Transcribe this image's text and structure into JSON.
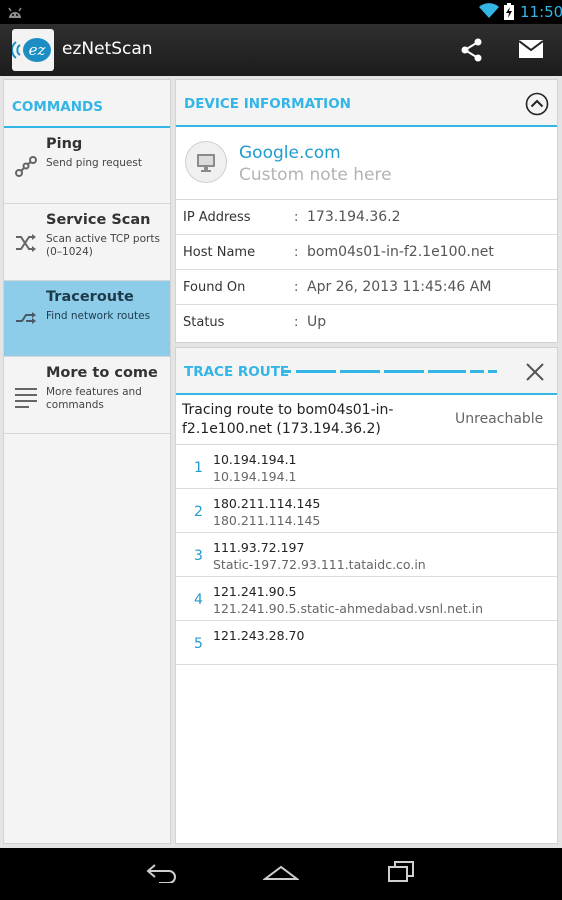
{
  "status_bar": {
    "time": "11:50"
  },
  "app": {
    "title": "ezNetScan",
    "logo_text": "ez"
  },
  "commands": {
    "header": "COMMANDS",
    "items": [
      {
        "title": "Ping",
        "description": "Send ping request",
        "icon": "ping-icon",
        "selected": false
      },
      {
        "title": "Service Scan",
        "description": "Scan active TCP ports (0–1024)",
        "icon": "shuffle-icon",
        "selected": false
      },
      {
        "title": "Traceroute",
        "description": "Find network routes",
        "icon": "route-icon",
        "selected": true
      },
      {
        "title": "More to come",
        "description": "More features and commands",
        "icon": "menu-lines-icon",
        "selected": false
      }
    ]
  },
  "device_info": {
    "header": "DEVICE INFORMATION",
    "name": "Google.com",
    "note_placeholder": "Custom note here",
    "separator": ":",
    "rows": [
      {
        "label": "IP Address",
        "value": "173.194.36.2"
      },
      {
        "label": "Host Name",
        "value": "bom04s01-in-f2.1e100.net"
      },
      {
        "label": "Found On",
        "value": "Apr 26, 2013 11:45:46 AM"
      },
      {
        "label": "Status",
        "value": "Up"
      }
    ]
  },
  "trace_route": {
    "header": "TRACE ROUTE",
    "target": "Tracing route to bom04s01-in-f2.1e100.net (173.194.36.2)",
    "status": "Unreachable",
    "hops": [
      {
        "num": "1",
        "ip": "10.194.194.1",
        "host": "10.194.194.1"
      },
      {
        "num": "2",
        "ip": "180.211.114.145",
        "host": "180.211.114.145"
      },
      {
        "num": "3",
        "ip": "111.93.72.197",
        "host": "Static-197.72.93.111.tataidc.co.in"
      },
      {
        "num": "4",
        "ip": "121.241.90.5",
        "host": "121.241.90.5.static-ahmedabad.vsnl.net.in"
      },
      {
        "num": "5",
        "ip": "121.243.28.70",
        "host": ""
      }
    ]
  },
  "colors": {
    "accent": "#33b5e5",
    "selected_bg": "#8ecdea",
    "link": "#1f9bd0"
  }
}
